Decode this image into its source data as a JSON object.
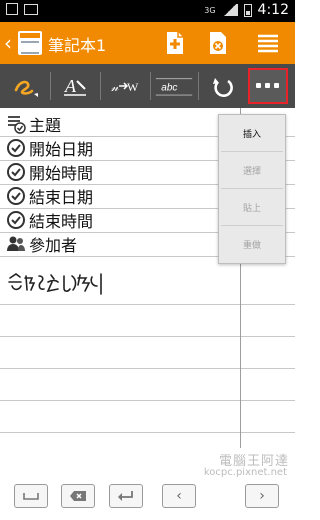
{
  "status": {
    "network": "3G",
    "time": "4:12"
  },
  "header": {
    "title": "筆記本1"
  },
  "fields": [
    {
      "icon": "subject-icon",
      "label": "主題"
    },
    {
      "icon": "check-icon",
      "label": "開始日期"
    },
    {
      "icon": "check-icon",
      "label": "開始時間"
    },
    {
      "icon": "check-icon",
      "label": "結束日期"
    },
    {
      "icon": "check-icon",
      "label": "結束時間"
    },
    {
      "icon": "people-icon",
      "label": "參加者"
    }
  ],
  "toolbar": {
    "text_tool": "abc"
  },
  "menu": {
    "items": [
      {
        "label": "插入",
        "enabled": true
      },
      {
        "label": "選擇",
        "enabled": false
      },
      {
        "label": "貼上",
        "enabled": false
      },
      {
        "label": "重做",
        "enabled": false
      }
    ]
  },
  "watermark": {
    "text": "電腦王阿達",
    "url": "kocpc.pixnet.net"
  },
  "handwriting": {
    "text": "会議記錄"
  }
}
